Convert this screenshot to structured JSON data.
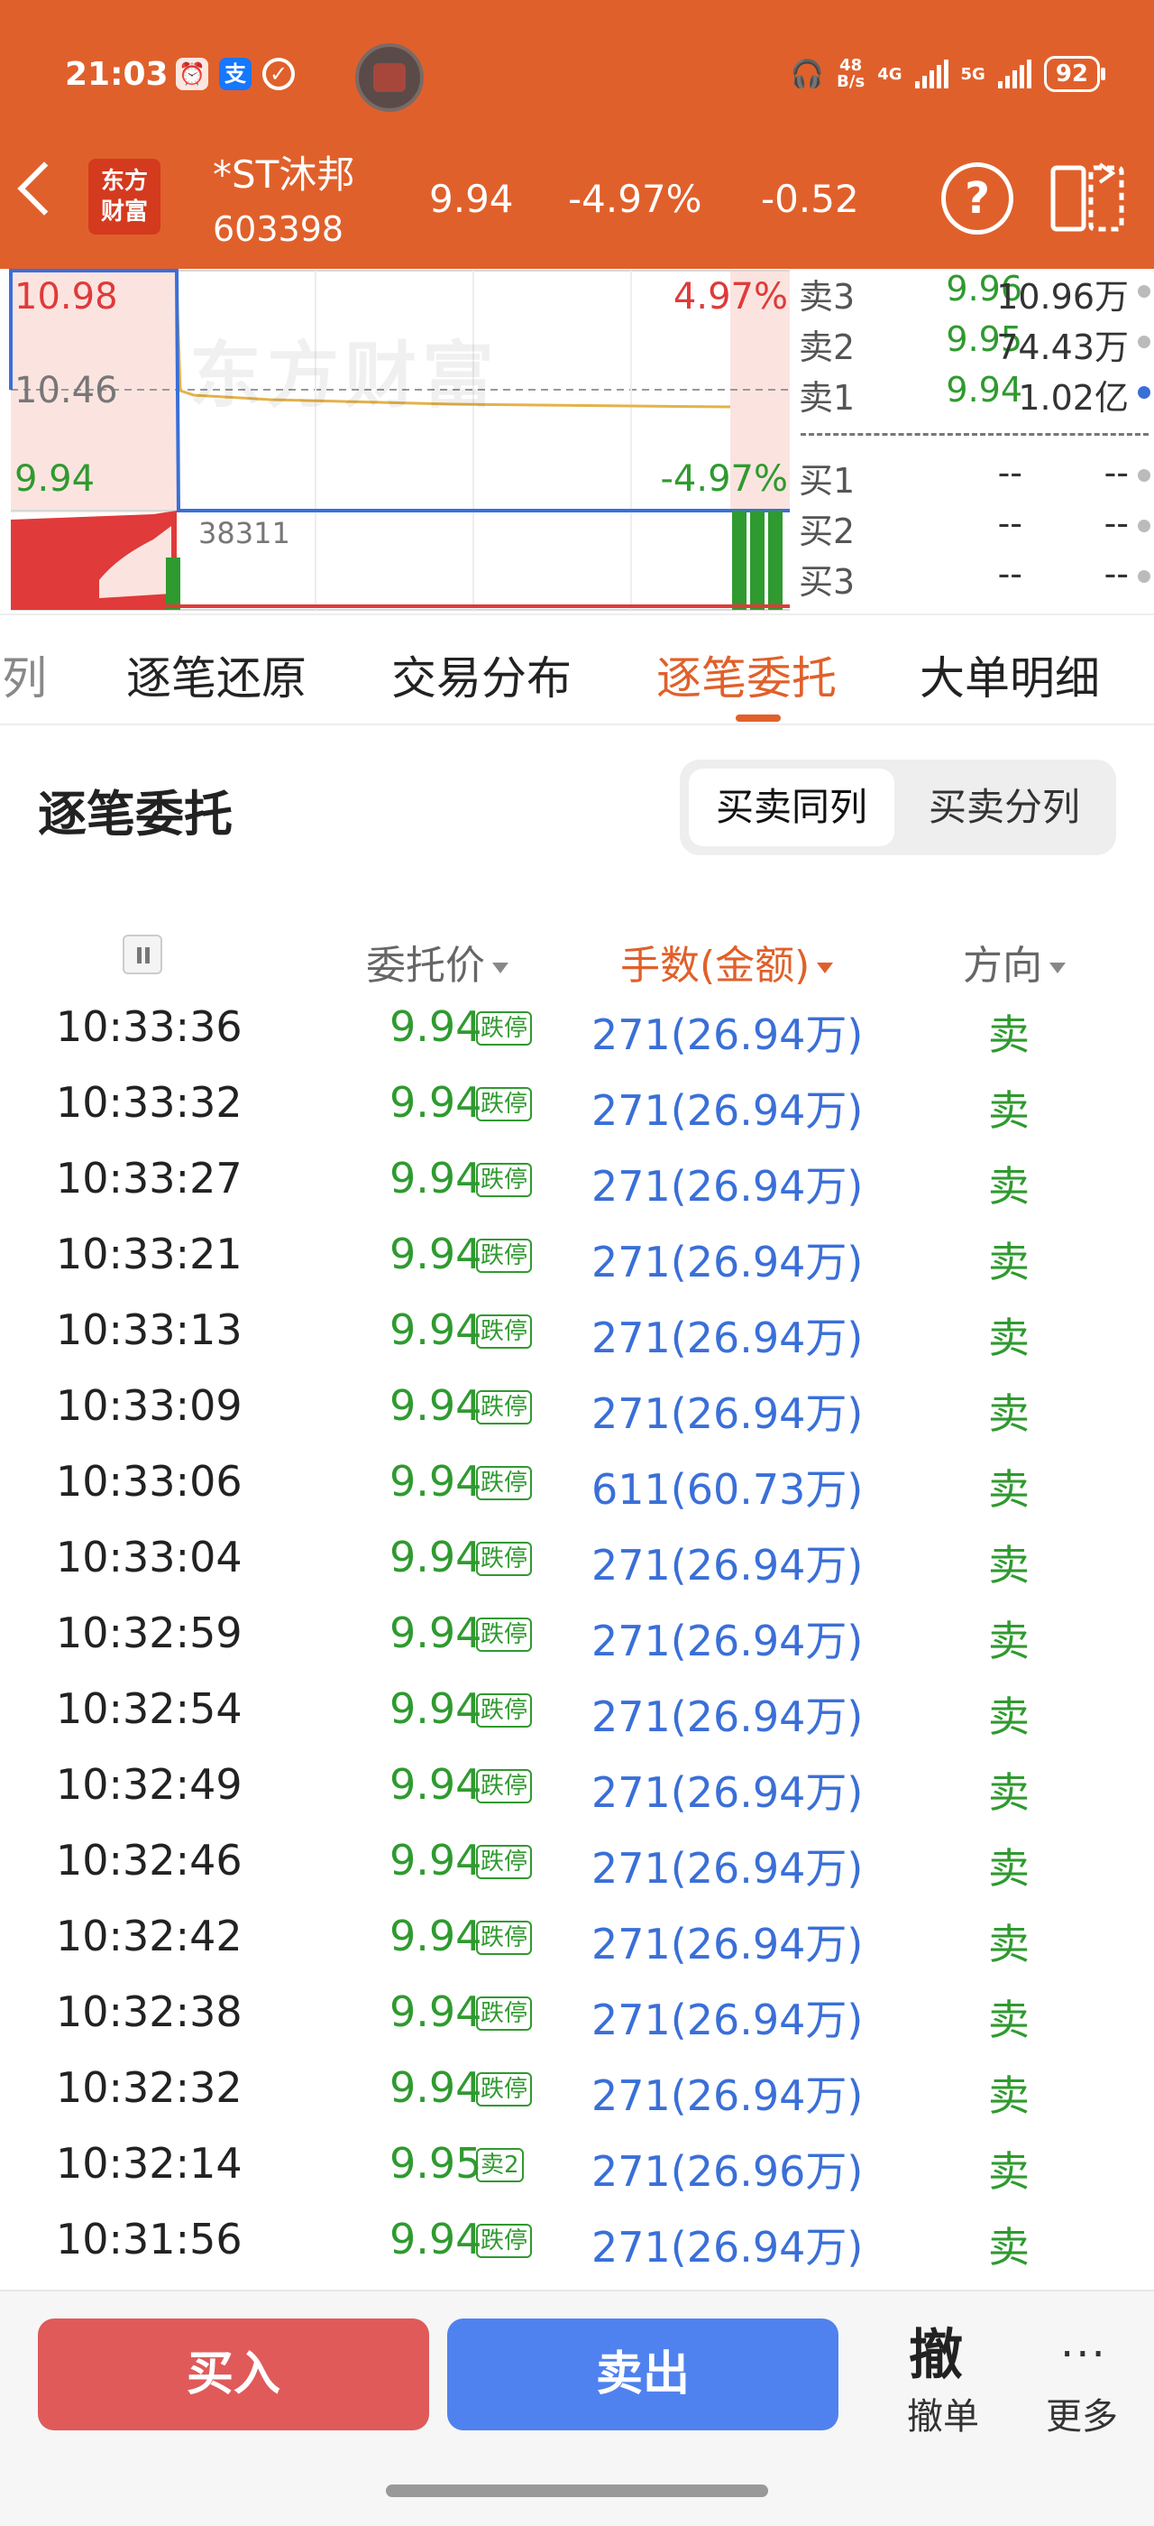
{
  "status_bar": {
    "time": "21:03",
    "left_icons": [
      "alarm-icon",
      "alipay-icon",
      "notification-icon"
    ],
    "net_speed": "48\nB/s",
    "signal_1": "4G",
    "signal_2": "5G",
    "battery": "92"
  },
  "header": {
    "logo_line1": "东方",
    "logo_line2": "财富",
    "stock_name": "*ST沐邦",
    "stock_code": "603398",
    "price": "9.94",
    "change_pct": "-4.97%",
    "change": "-0.52",
    "bg_color": "#e0602b"
  },
  "chart": {
    "top_price": "10.98",
    "mid_price": "10.46",
    "low_price": "9.94",
    "top_pct": "4.97%",
    "low_pct": "-4.97%",
    "volume": "38311",
    "watermark": "东方财富"
  },
  "orderbook": {
    "asks": [
      {
        "label": "卖3",
        "price": "9.96",
        "volume": "10.96万"
      },
      {
        "label": "卖2",
        "price": "9.95",
        "volume": "74.43万"
      },
      {
        "label": "卖1",
        "price": "9.94",
        "volume": "1.02亿"
      }
    ],
    "bids": [
      {
        "label": "买1",
        "price": "--",
        "volume": "--"
      },
      {
        "label": "买2",
        "price": "--",
        "volume": "--"
      },
      {
        "label": "买3",
        "price": "--",
        "volume": "--"
      }
    ]
  },
  "tabs": [
    "列",
    "逐笔还原",
    "交易分布",
    "逐笔委托",
    "大单明细"
  ],
  "active_tab": "逐笔委托",
  "section": {
    "title": "逐笔委托",
    "toggle_on": "买卖同列",
    "toggle_off": "买卖分列"
  },
  "columns": {
    "price": "委托价",
    "amount": "手数(金额)",
    "direction": "方向"
  },
  "rows": [
    {
      "time": "10:33:36",
      "price": "9.94",
      "tag": "跌停",
      "amount": "271(26.94万)",
      "dir": "卖"
    },
    {
      "time": "10:33:32",
      "price": "9.94",
      "tag": "跌停",
      "amount": "271(26.94万)",
      "dir": "卖"
    },
    {
      "time": "10:33:27",
      "price": "9.94",
      "tag": "跌停",
      "amount": "271(26.94万)",
      "dir": "卖"
    },
    {
      "time": "10:33:21",
      "price": "9.94",
      "tag": "跌停",
      "amount": "271(26.94万)",
      "dir": "卖"
    },
    {
      "time": "10:33:13",
      "price": "9.94",
      "tag": "跌停",
      "amount": "271(26.94万)",
      "dir": "卖"
    },
    {
      "time": "10:33:09",
      "price": "9.94",
      "tag": "跌停",
      "amount": "271(26.94万)",
      "dir": "卖"
    },
    {
      "time": "10:33:06",
      "price": "9.94",
      "tag": "跌停",
      "amount": "611(60.73万)",
      "dir": "卖"
    },
    {
      "time": "10:33:04",
      "price": "9.94",
      "tag": "跌停",
      "amount": "271(26.94万)",
      "dir": "卖"
    },
    {
      "time": "10:32:59",
      "price": "9.94",
      "tag": "跌停",
      "amount": "271(26.94万)",
      "dir": "卖"
    },
    {
      "time": "10:32:54",
      "price": "9.94",
      "tag": "跌停",
      "amount": "271(26.94万)",
      "dir": "卖"
    },
    {
      "time": "10:32:49",
      "price": "9.94",
      "tag": "跌停",
      "amount": "271(26.94万)",
      "dir": "卖"
    },
    {
      "time": "10:32:46",
      "price": "9.94",
      "tag": "跌停",
      "amount": "271(26.94万)",
      "dir": "卖"
    },
    {
      "time": "10:32:42",
      "price": "9.94",
      "tag": "跌停",
      "amount": "271(26.94万)",
      "dir": "卖"
    },
    {
      "time": "10:32:38",
      "price": "9.94",
      "tag": "跌停",
      "amount": "271(26.94万)",
      "dir": "卖"
    },
    {
      "time": "10:32:32",
      "price": "9.94",
      "tag": "跌停",
      "amount": "271(26.94万)",
      "dir": "卖"
    },
    {
      "time": "10:32:14",
      "price": "9.95",
      "tag": "卖2",
      "amount": "271(26.96万)",
      "dir": "卖"
    },
    {
      "time": "10:31:56",
      "price": "9.94",
      "tag": "跌停",
      "amount": "271(26.94万)",
      "dir": "卖"
    }
  ],
  "bottom": {
    "buy": "买入",
    "sell": "卖出",
    "cancel_icon_text": "撤",
    "cancel": "撤单",
    "more_icon_text": "···",
    "more": "更多"
  },
  "colors": {
    "up": "#e03a3a",
    "down": "#2f9a2f",
    "amount": "#3a6fd8",
    "accent": "#e0602b"
  }
}
